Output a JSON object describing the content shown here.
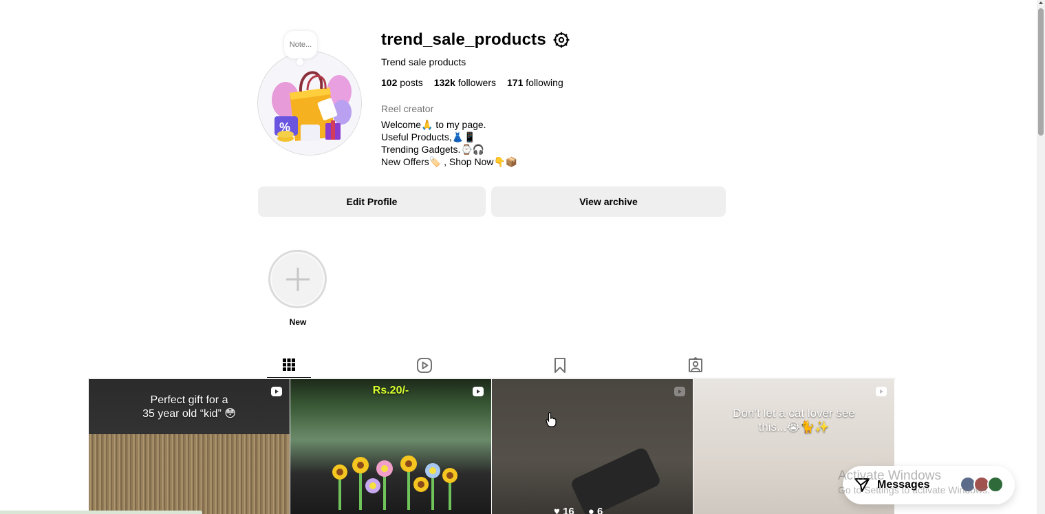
{
  "profile": {
    "note": "Note...",
    "username": "trend_sale_products",
    "full_name": "Trend sale products",
    "stats": {
      "posts_count": "102",
      "posts_label": "posts",
      "followers_count": "132k",
      "followers_label": "followers",
      "following_count": "171",
      "following_label": "following"
    },
    "category": "Reel creator",
    "bio": [
      "Welcome🙏 to my page.",
      "Useful Products,👗📱",
      "Trending Gadgets.⌚🎧",
      "New Offers🏷️ , Shop Now👇📦"
    ]
  },
  "actions": {
    "edit_profile": "Edit Profile",
    "view_archive": "View archive"
  },
  "highlights": {
    "new_label": "New"
  },
  "tabs": [
    {
      "name": "posts",
      "icon": "grid-icon",
      "active": true
    },
    {
      "name": "reels",
      "icon": "reels-icon",
      "active": false
    },
    {
      "name": "saved",
      "icon": "bookmark-icon",
      "active": false
    },
    {
      "name": "tagged",
      "icon": "tagged-icon",
      "active": false
    }
  ],
  "posts": [
    {
      "caption_line1": "Perfect gift for a",
      "caption_line2": "35 year old “kid” 😳",
      "type": "reel"
    },
    {
      "price": "Rs.20/-",
      "type": "reel"
    },
    {
      "likes": "16",
      "comments": "6",
      "type": "reel"
    },
    {
      "caption_line1": "Don’t let a cat lover see",
      "caption_line2": "this...😭🐈✨",
      "type": "reel"
    }
  ],
  "messages": {
    "label": "Messages"
  },
  "watermark": {
    "title": "Activate Windows",
    "subtitle": "Go to Settings to activate Windows."
  },
  "colors": {
    "button_bg": "#efefef",
    "muted_text": "#737373",
    "price_text": "#d8ff2e"
  }
}
